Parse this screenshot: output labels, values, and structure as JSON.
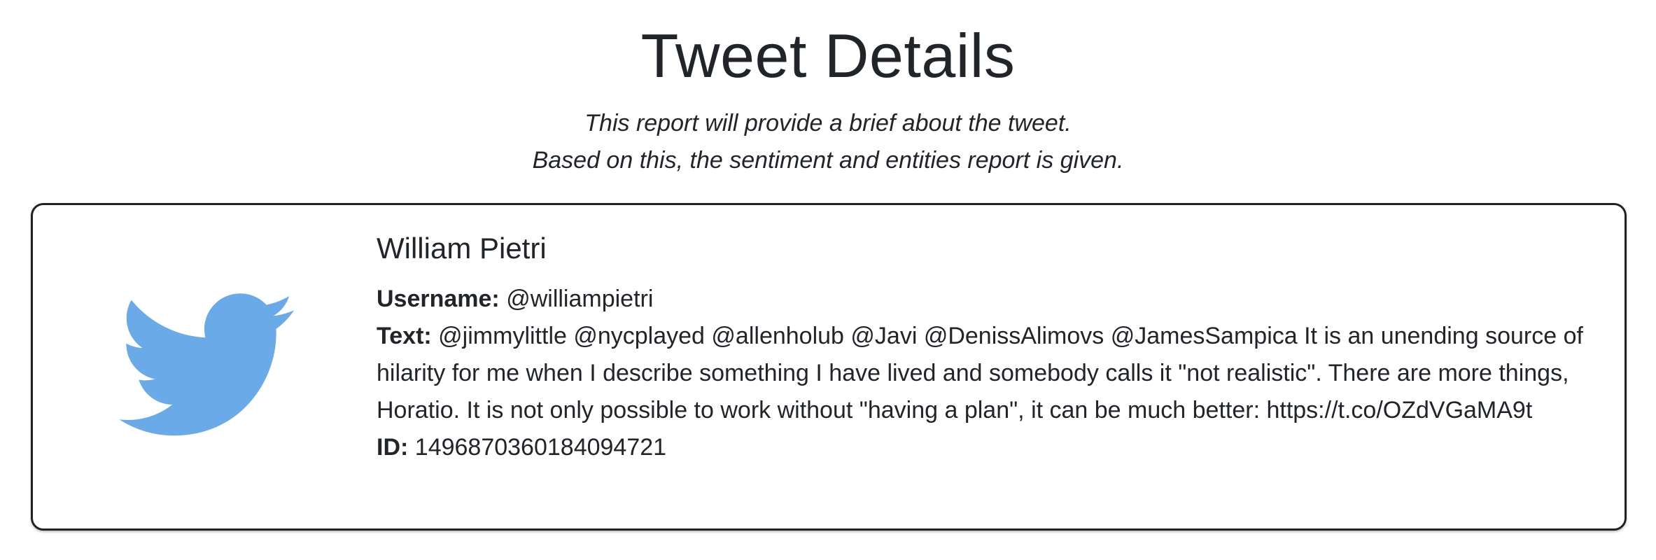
{
  "page": {
    "title": "Tweet Details",
    "subtitle_line1": "This report will provide a brief about the tweet.",
    "subtitle_line2": "Based on this, the sentiment and entities report is given."
  },
  "tweet": {
    "icon": "twitter-bird-icon",
    "icon_color": "#6aaae8",
    "author_name": "William Pietri",
    "username_label": "Username:",
    "username": "@williampietri",
    "text_label": "Text:",
    "text": "@jimmylittle @nycplayed @allenholub @Javi @DenissAlimovs @JamesSampica It is an unending source of hilarity for me when I describe something I have lived and somebody calls it \"not realistic\". There are more things, Horatio. It is not only possible to work without \"having a plan\", it can be much better: https://t.co/OZdVGaMA9t",
    "id_label": "ID:",
    "id": "1496870360184094721"
  }
}
